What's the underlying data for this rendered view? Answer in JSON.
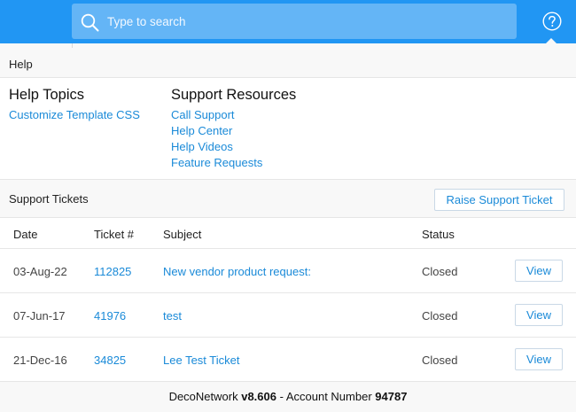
{
  "search": {
    "placeholder": "Type to search"
  },
  "help_header": {
    "label": "Help"
  },
  "help_topics": {
    "title": "Help Topics",
    "links": [
      "Customize Template CSS"
    ]
  },
  "support_resources": {
    "title": "Support Resources",
    "links": [
      "Call Support",
      "Help Center",
      "Help Videos",
      "Feature Requests"
    ]
  },
  "tickets": {
    "title": "Support Tickets",
    "raise_label": "Raise Support Ticket",
    "columns": [
      "Date",
      "Ticket #",
      "Subject",
      "Status"
    ],
    "view_label": "View",
    "rows": [
      {
        "date": "03-Aug-22",
        "ticket": "112825",
        "subject": "New vendor product request:",
        "status": "Closed"
      },
      {
        "date": "07-Jun-17",
        "ticket": "41976",
        "subject": "test",
        "status": "Closed"
      },
      {
        "date": "21-Dec-16",
        "ticket": "34825",
        "subject": "Lee Test Ticket",
        "status": "Closed"
      }
    ]
  },
  "footer": {
    "brand": "DecoNetwork",
    "version": "v8.606",
    "separator": " - ",
    "account_label": "Account Number",
    "account_number": "94787"
  },
  "colors": {
    "accent": "#2196f3",
    "search_bg": "#64b5f6",
    "link": "#1a8ad8"
  },
  "icons": {
    "search": "search-icon",
    "help": "question-circle-icon"
  }
}
